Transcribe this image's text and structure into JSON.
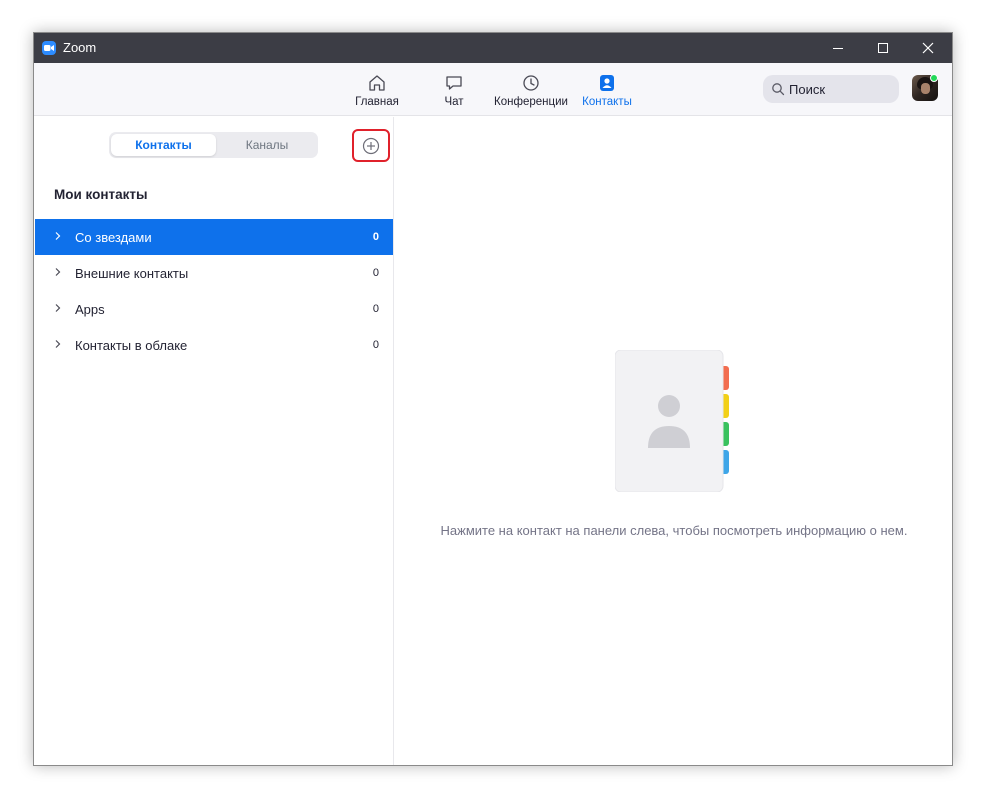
{
  "window": {
    "title": "Zoom",
    "controls": {
      "minimize": "minimize-icon",
      "maximize": "maximize-icon",
      "close": "close-icon"
    }
  },
  "nav": {
    "items": [
      {
        "label": "Главная",
        "icon": "home-icon"
      },
      {
        "label": "Чат",
        "icon": "chat-icon"
      },
      {
        "label": "Конференции",
        "icon": "clock-icon"
      },
      {
        "label": "Контакты",
        "icon": "contacts-icon",
        "active": true
      }
    ],
    "search_placeholder": "Поиск"
  },
  "sidebar": {
    "tabs": [
      {
        "label": "Контакты",
        "active": true
      },
      {
        "label": "Каналы",
        "active": false
      }
    ],
    "add_button_icon": "plus-circle-icon",
    "section_title": "Мои контакты",
    "groups": [
      {
        "name": "Со звездами",
        "count": "0",
        "selected": true
      },
      {
        "name": "Внешние контакты",
        "count": "0"
      },
      {
        "name": "Apps",
        "count": "0"
      },
      {
        "name": "Контакты в облаке",
        "count": "0"
      }
    ]
  },
  "main": {
    "empty_hint": "Нажмите на контакт на панели слева, чтобы посмотреть информацию о нем."
  },
  "colors": {
    "accent": "#0e71eb",
    "titlebar": "#3c3d45",
    "highlight": "#e0212b",
    "presence": "#23d959",
    "tab_colors": [
      "#f26d4f",
      "#f2d018",
      "#3ac25e",
      "#3fa6e8"
    ]
  }
}
